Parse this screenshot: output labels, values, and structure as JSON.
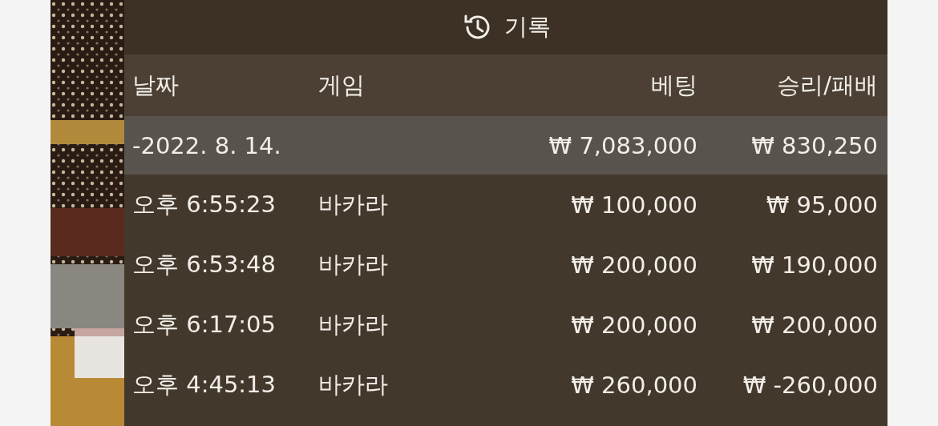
{
  "header": {
    "title": "기록"
  },
  "table": {
    "columns": [
      "날짜",
      "게임",
      "베팅",
      "승리/패배"
    ],
    "group": {
      "date": "-2022. 8. 14.",
      "bet": "₩ 7,083,000",
      "result": "₩ 830,250"
    },
    "rows": [
      {
        "time": "오후 6:55:23",
        "game": "바카라",
        "bet": "₩ 100,000",
        "result": "₩ 95,000"
      },
      {
        "time": "오후 6:53:48",
        "game": "바카라",
        "bet": "₩ 200,000",
        "result": "₩ 190,000"
      },
      {
        "time": "오후 6:17:05",
        "game": "바카라",
        "bet": "₩ 200,000",
        "result": "₩ 200,000"
      },
      {
        "time": "오후 4:45:13",
        "game": "바카라",
        "bet": "₩ 260,000",
        "result": "₩ -260,000"
      }
    ]
  }
}
